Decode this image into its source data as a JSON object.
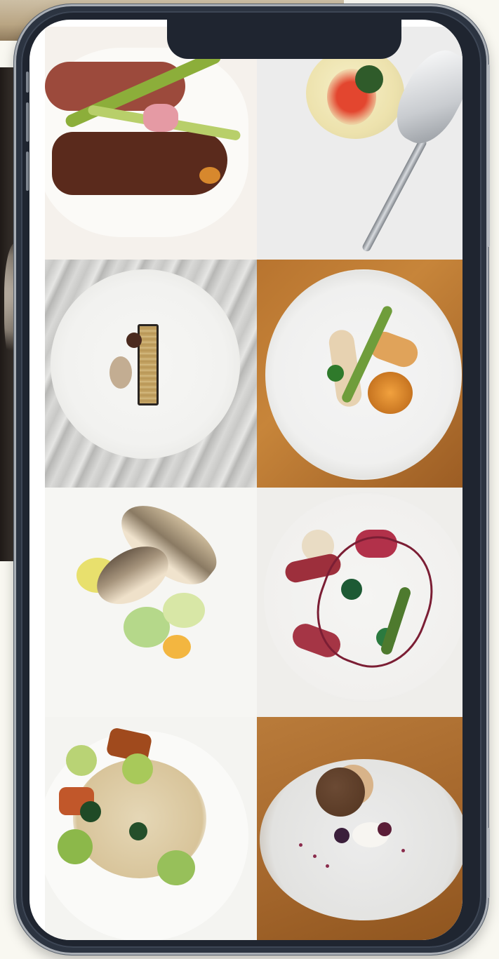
{
  "page": {
    "background_color": "#f9f8f1",
    "phone_color": "#2c3441"
  },
  "gallery": {
    "tiles": [
      {
        "name": "photo-steak-asparagus"
      },
      {
        "name": "photo-dome-dessert-spoon"
      },
      {
        "name": "photo-terrine-marble"
      },
      {
        "name": "photo-chicken-wood"
      },
      {
        "name": "photo-fish-fennel"
      },
      {
        "name": "photo-duck-salad"
      },
      {
        "name": "photo-grain-grape-salad"
      },
      {
        "name": "photo-dessert-ceramic-plate"
      }
    ]
  }
}
